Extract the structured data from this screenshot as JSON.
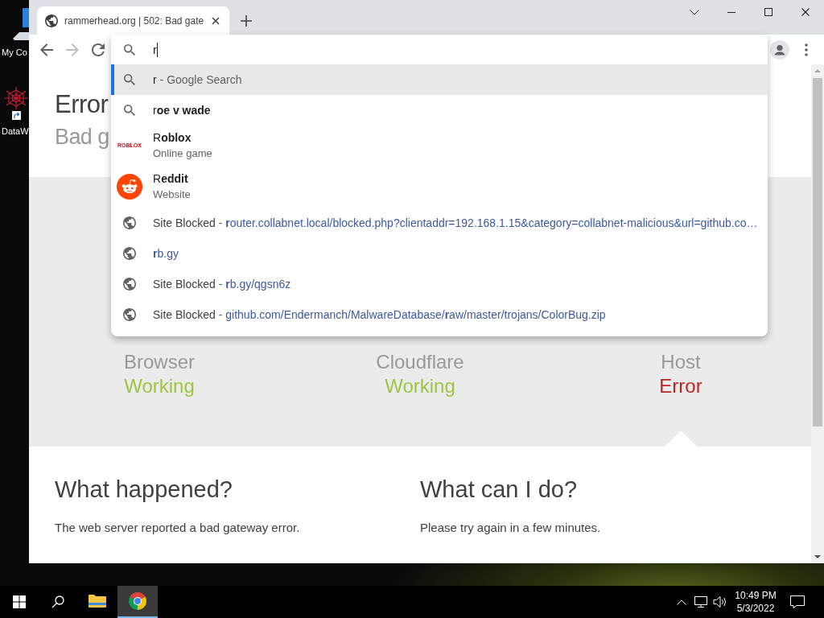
{
  "desktop": {
    "icons": [
      {
        "kind": "computer",
        "label": "My Co"
      },
      {
        "kind": "shortcut",
        "label": "DataW"
      }
    ]
  },
  "browser": {
    "tabs": [
      {
        "title": "rammerhead.org | 502: Bad gate",
        "selected": true
      }
    ],
    "nav": [
      {
        "kind": "back",
        "disabled": false
      },
      {
        "kind": "forward",
        "disabled": true
      },
      {
        "kind": "reload",
        "disabled": false
      }
    ],
    "omnibox": {
      "value": "r"
    },
    "suggestions": [
      {
        "kind": "search",
        "text": "r",
        "separator": "-",
        "detail": "Google Search",
        "selected": true
      },
      {
        "kind": "search",
        "text": "r**oe v wade**",
        "selected": false
      },
      {
        "kind": "wordmark",
        "logo": "ROBLOX",
        "text": "R**oblox**",
        "detail": "Online game",
        "selected": false
      },
      {
        "kind": "badge",
        "text": "R**eddit**",
        "detail": "Website",
        "selected": false
      },
      {
        "kind": "url",
        "title": "Site Blocked",
        "separator": "-",
        "url": "**r**outer.collabnet.local/blocked.php?clientaddr=192.168.1.15&category=collabnet-malicious&url=github.co…",
        "selected": false
      },
      {
        "kind": "url",
        "url": "**r**b.gy",
        "selected": false
      },
      {
        "kind": "url",
        "title": "Site Blocked",
        "separator": "-",
        "url": "**r**b.gy/qgsn6z",
        "selected": false
      },
      {
        "kind": "url",
        "title": "Site Blocked",
        "separator": "-",
        "url": "github.com/Endermanch/MalwareDatabase/**r**aw/master/trojans/ColorBug.zip",
        "selected": false
      }
    ]
  },
  "page": {
    "title": "Error",
    "subtitle": "Bad g",
    "status": [
      {
        "label": "Browser",
        "state": "Working",
        "ok": true
      },
      {
        "label": "Cloudflare",
        "state": "Working",
        "ok": true
      },
      {
        "label": "Host",
        "state": "Error",
        "ok": false
      }
    ],
    "sections": [
      {
        "heading": "What happened?",
        "body": "The web server reported a bad gateway error."
      },
      {
        "heading": "What can I do?",
        "body": "Please try again in a few minutes."
      }
    ]
  },
  "taskbar": {
    "apps": [
      {
        "kind": "folder",
        "active": false
      },
      {
        "kind": "chrome",
        "active": true
      }
    ],
    "clock": {
      "time": "10:49 PM",
      "date": "5/3/2022"
    }
  }
}
